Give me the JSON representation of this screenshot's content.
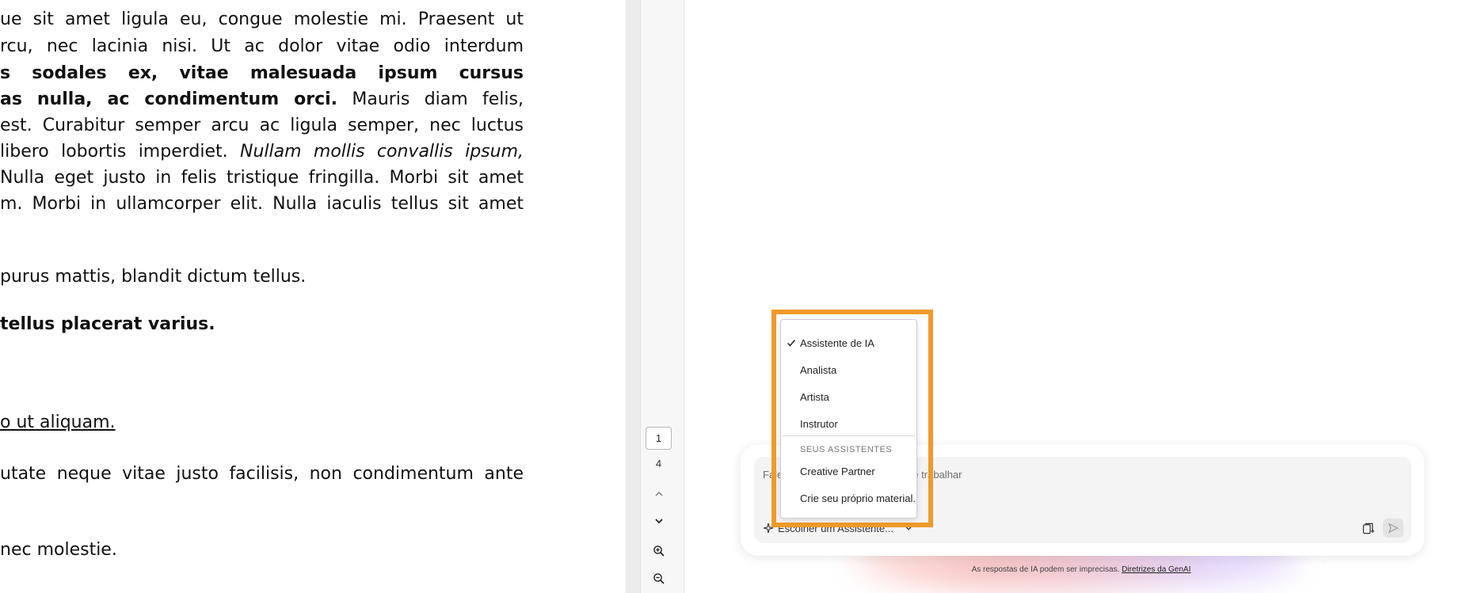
{
  "document": {
    "lines": [
      {
        "id": "l1",
        "text": "ue sit amet ligula eu, congue molestie mi. Praesent ut"
      },
      {
        "id": "l2",
        "text": "rcu, nec lacinia nisi. Ut ac dolor vitae odio interdum"
      },
      {
        "id": "l3",
        "text": "s sodales ex, vitae malesuada ipsum cursus"
      },
      {
        "id": "l4_bold",
        "text": "as nulla, ac condimentum orci."
      },
      {
        "id": "l4_rest",
        "text": " Mauris diam felis,"
      },
      {
        "id": "l5",
        "text": " est. Curabitur semper arcu ac ligula semper, nec luctus"
      },
      {
        "id": "l6_plain",
        "text": "libero lobortis imperdiet. "
      },
      {
        "id": "l6_italic",
        "text": "Nullam mollis convallis ipsum,"
      },
      {
        "id": "l7",
        "text": "Nulla eget justo in felis tristique fringilla. Morbi sit amet"
      },
      {
        "id": "l8",
        "text": "m. Morbi in ullamcorper elit. Nulla iaculis tellus sit amet"
      },
      {
        "id": "l9",
        "text": " purus mattis, blandit dictum tellus."
      },
      {
        "id": "l10",
        "text": " tellus placerat varius."
      },
      {
        "id": "l11",
        "text": "o ut aliquam. "
      },
      {
        "id": "l12",
        "text": "utate neque vitae justo facilisis, non condimentum ante"
      },
      {
        "id": "l13",
        "text": "nec molestie."
      }
    ]
  },
  "navigation": {
    "current_page": "1",
    "total_pages": "4"
  },
  "assistant": {
    "prompt_placeholder": "Fale sobre o que você gostaria de trabalhar",
    "chooser_label": "Escolher um Assistente...",
    "disclaimer_text": "As respostas de IA podem ser imprecisas.",
    "disclaimer_link": "Diretrizes da GenAI"
  },
  "menu": {
    "items": [
      {
        "label": "Assistente de IA",
        "checked": true
      },
      {
        "label": "Analista",
        "checked": false
      },
      {
        "label": "Artista",
        "checked": false
      },
      {
        "label": "Instrutor",
        "checked": false
      }
    ],
    "section_label": "SEUS ASSISTENTES",
    "custom_items": [
      {
        "label": "Creative Partner"
      },
      {
        "label": "Crie seu próprio material..."
      }
    ]
  },
  "colors": {
    "highlight": "#ef9a2a",
    "menu_border": "#cfcfcf",
    "composer_bg": "#f4f4f4"
  },
  "icons": {
    "check": "check-icon",
    "chooser": "sparkle-assistant-icon",
    "chevron": "chevron-down-icon",
    "attach": "attach-file-icon",
    "send": "send-icon",
    "zoom_in": "zoom-in-icon",
    "zoom_out": "zoom-out-icon",
    "page_up": "chevron-up-icon",
    "page_down": "chevron-down-icon"
  }
}
